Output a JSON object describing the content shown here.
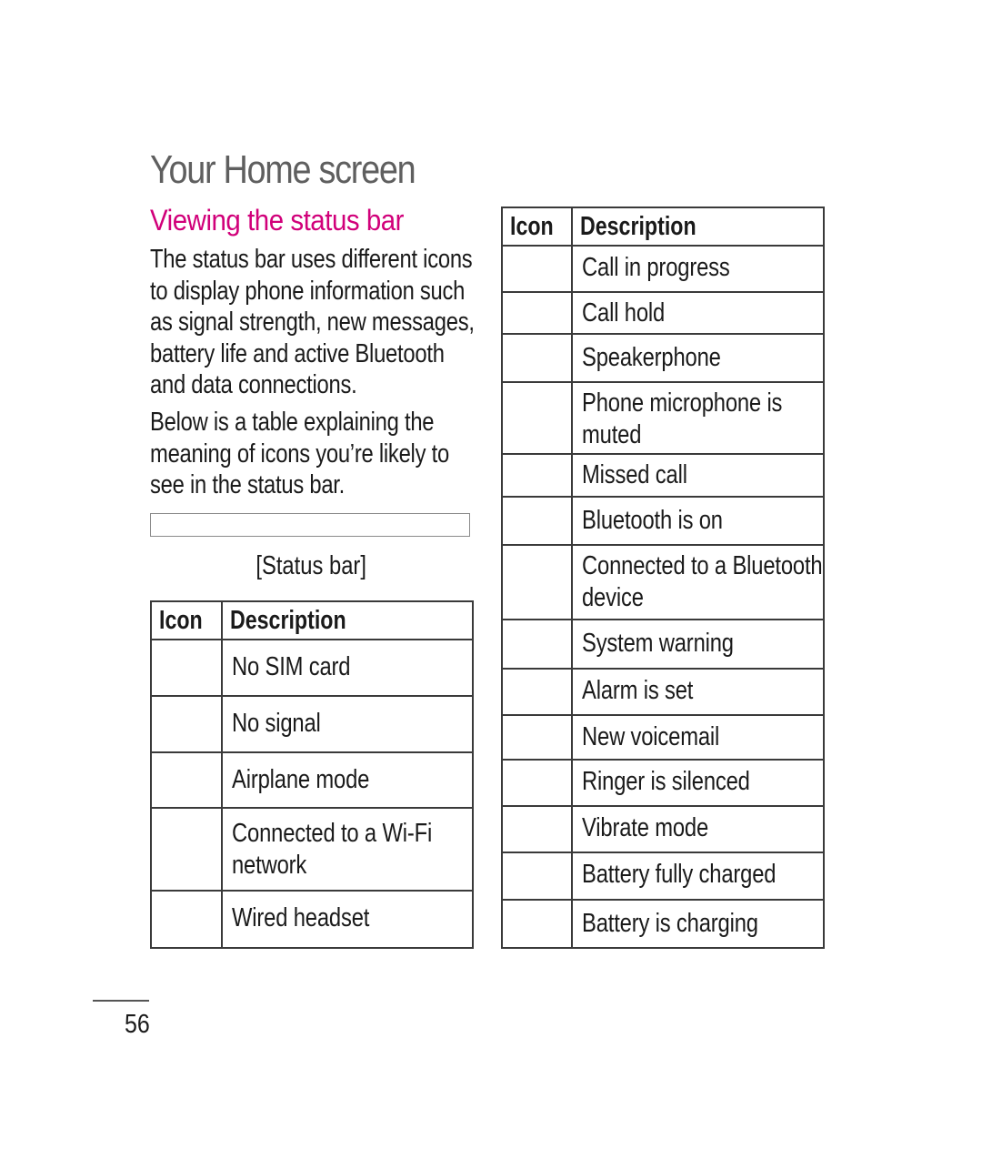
{
  "page": {
    "title": "Your Home screen",
    "section_title": "Viewing the status bar",
    "paragraphs": [
      "The status bar uses different icons to display phone information such as signal strength, new messages, battery life and active Bluetooth and data connections.",
      "Below is a table explaining the meaning of icons you’re likely to see in the status bar."
    ],
    "status_bar_caption": "[Status bar]",
    "page_number": "56",
    "accent_color": "#d1007a",
    "title_color": "#5f5f5f"
  },
  "left_table": {
    "headers": [
      "Icon",
      "Description"
    ],
    "rows": [
      {
        "icon": "",
        "description_lines": [
          "No SIM card"
        ]
      },
      {
        "icon": "",
        "description_lines": [
          "No signal"
        ]
      },
      {
        "icon": "",
        "description_lines": [
          "Airplane mode"
        ]
      },
      {
        "icon": "",
        "description_lines": [
          "Connected to a Wi-Fi",
          "network"
        ]
      },
      {
        "icon": "",
        "description_lines": [
          "Wired headset"
        ]
      }
    ]
  },
  "right_table": {
    "headers": [
      "Icon",
      "Description"
    ],
    "rows": [
      {
        "icon": "",
        "description_lines": [
          "Call in progress"
        ]
      },
      {
        "icon": "",
        "description_lines": [
          "Call hold"
        ]
      },
      {
        "icon": "",
        "description_lines": [
          "Speakerphone"
        ]
      },
      {
        "icon": "",
        "description_lines": [
          "Phone microphone is",
          "muted"
        ]
      },
      {
        "icon": "",
        "description_lines": [
          "Missed call"
        ]
      },
      {
        "icon": "",
        "description_lines": [
          "Bluetooth is on"
        ]
      },
      {
        "icon": "",
        "description_lines": [
          "Connected to a Bluetooth",
          "device"
        ]
      },
      {
        "icon": "",
        "description_lines": [
          "System warning"
        ]
      },
      {
        "icon": "",
        "description_lines": [
          "Alarm is set"
        ]
      },
      {
        "icon": "",
        "description_lines": [
          "New voicemail"
        ]
      },
      {
        "icon": "",
        "description_lines": [
          "Ringer is silenced"
        ]
      },
      {
        "icon": "",
        "description_lines": [
          "Vibrate mode"
        ]
      },
      {
        "icon": "",
        "description_lines": [
          "Battery fully charged"
        ]
      },
      {
        "icon": "",
        "description_lines": [
          "Battery is charging"
        ]
      }
    ]
  }
}
